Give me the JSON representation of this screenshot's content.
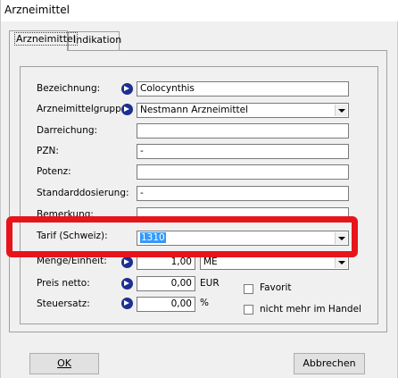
{
  "window": {
    "title": "Arzneimittel"
  },
  "tabs": [
    {
      "label": "Arzneimittel"
    },
    {
      "label": "Indikation"
    }
  ],
  "form": {
    "bezeichnung": {
      "label": "Bezeichnung:",
      "value": "Colocynthis"
    },
    "gruppe": {
      "label": "Arzneimittelgruppe:",
      "value": "Nestmann Arzneimittel"
    },
    "darreichung": {
      "label": "Darreichung:",
      "value": ""
    },
    "pzn": {
      "label": "PZN:",
      "value": "-"
    },
    "potenz": {
      "label": "Potenz:",
      "value": ""
    },
    "standarddosierung": {
      "label": "Standarddosierung:",
      "value": "-"
    },
    "bemerkung": {
      "label": "Bemerkung:",
      "value": ""
    },
    "tarif": {
      "label": "Tarif (Schweiz):",
      "value": "1310"
    },
    "menge": {
      "label": "Menge/Einheit:",
      "value": "1,00",
      "unit": "ME"
    },
    "preis": {
      "label": "Preis netto:",
      "value": "0,00",
      "unit": "EUR"
    },
    "steuersatz": {
      "label": "Steuersatz:",
      "value": "0,00",
      "unit": "%"
    },
    "favorit": {
      "label": "Favorit",
      "checked": false
    },
    "nicht_mehr": {
      "label": "nicht mehr im Handel",
      "checked": false
    }
  },
  "buttons": {
    "ok": "OK",
    "abbrechen": "Abbrechen"
  },
  "colors": {
    "highlight_box": "#e8141b",
    "selection": "#3399ff",
    "nav_icon": "#1d2f8f"
  }
}
